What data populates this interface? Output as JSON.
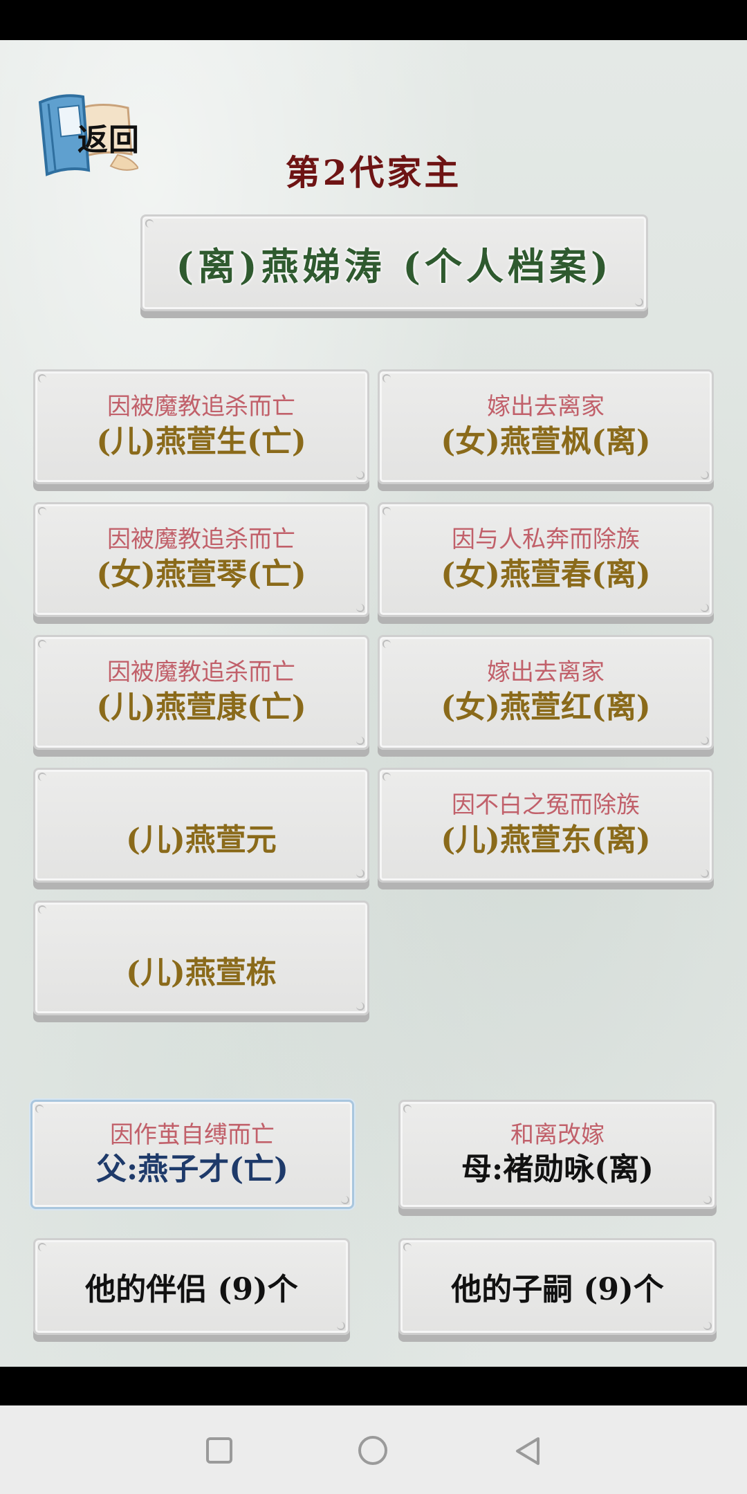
{
  "header": {
    "back_label": "返回",
    "title": "第2代家主"
  },
  "profile": {
    "label": "(离)燕娣涛 (个人档案)"
  },
  "children": [
    {
      "reason": "因被魔教追杀而亡",
      "name": "(儿)燕萱生(亡)"
    },
    {
      "reason": "嫁出去离家",
      "name": "(女)燕萱枫(离)"
    },
    {
      "reason": "因被魔教追杀而亡",
      "name": "(女)燕萱琴(亡)"
    },
    {
      "reason": "因与人私奔而除族",
      "name": "(女)燕萱春(离)"
    },
    {
      "reason": "因被魔教追杀而亡",
      "name": "(儿)燕萱康(亡)"
    },
    {
      "reason": "嫁出去离家",
      "name": "(女)燕萱红(离)"
    },
    {
      "reason": "",
      "name": "(儿)燕萱元"
    },
    {
      "reason": "因不白之冤而除族",
      "name": "(儿)燕萱东(离)"
    },
    {
      "reason": "",
      "name": "(儿)燕萱栋"
    }
  ],
  "parents": {
    "father": {
      "reason": "因作茧自缚而亡",
      "name": "父:燕子才(亡)"
    },
    "mother": {
      "reason": "和离改嫁",
      "name": "母:褚勋咏(离)"
    }
  },
  "buttons": {
    "partners": "他的伴侣 (9)个",
    "children": "他的子嗣 (9)个"
  }
}
